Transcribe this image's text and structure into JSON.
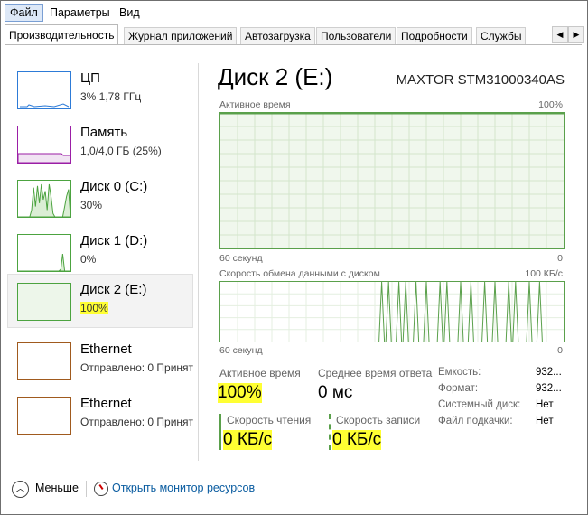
{
  "menu": {
    "items": [
      "Файл",
      "Параметры",
      "Вид"
    ]
  },
  "tabs": [
    "Производительность",
    "Журнал приложений",
    "Автозагрузка",
    "Пользователи",
    "Подробности",
    "Службы"
  ],
  "sidebar": {
    "items": [
      {
        "name": "ЦП",
        "sub": "3% 1,78 ГГц",
        "color": "#2d7bd7"
      },
      {
        "name": "Память",
        "sub": "1,0/4,0 ГБ (25%)",
        "color": "#9b1ea6"
      },
      {
        "name": "Диск 0 (C:)",
        "sub": "30%",
        "color": "#4ca340",
        "levels": [
          0,
          0,
          0,
          0,
          0,
          0,
          0,
          0.2,
          0.85,
          0.3,
          0.9,
          0.4,
          0.95,
          0.5,
          0.75,
          0.2,
          0.95,
          0.6,
          0.1,
          0,
          0,
          0,
          0,
          0,
          0.3,
          0.6,
          0.8,
          0
        ]
      },
      {
        "name": "Диск 1 (D:)",
        "sub": "0%",
        "color": "#4ca340",
        "levels": [
          0,
          0,
          0,
          0,
          0,
          0,
          0,
          0,
          0,
          0,
          0,
          0,
          0,
          0,
          0,
          0,
          0,
          0,
          0,
          0,
          0,
          0,
          0.05,
          0.5,
          0,
          0,
          0,
          0
        ]
      },
      {
        "name": "Диск 2 (E:)",
        "sub": "100%",
        "color": "#4ca340"
      },
      {
        "name": "Ethernet",
        "sub": "Отправлено: 0 Принят",
        "color": "#a05a1e"
      },
      {
        "name": "Ethernet",
        "sub": "Отправлено: 0 Принят",
        "color": "#a05a1e"
      }
    ]
  },
  "main": {
    "title": "Диск 2 (E:)",
    "model": "MAXTOR STM31000340AS",
    "graph1": {
      "label": "Активное время",
      "max": "100%",
      "time": "60 секунд",
      "min": "0",
      "level": 1.0
    },
    "graph2": {
      "label": "Скорость обмена данными с диском",
      "max": "100 КБ/с",
      "time": "60 секунд",
      "min": "0",
      "spikes": [
        0.47,
        0.49,
        0.52,
        0.54,
        0.57,
        0.6,
        0.64,
        0.66,
        0.7,
        0.73,
        0.77,
        0.8,
        0.84,
        0.86,
        0.9,
        0.93
      ]
    },
    "stats": {
      "active_label": "Активное время",
      "active_value": "100%",
      "resp_label": "Среднее время ответа",
      "resp_value": "0 мс",
      "read_label": "Скорость чтения",
      "read_value": "0 КБ/с",
      "write_label": "Скорость записи",
      "write_value": "0 КБ/с"
    },
    "props": [
      {
        "key": "Емкость:",
        "value": "932..."
      },
      {
        "key": "Формат:",
        "value": "932..."
      },
      {
        "key": "Системный диск:",
        "value": "Нет"
      },
      {
        "key": "Файл подкачки:",
        "value": "Нет"
      }
    ]
  },
  "footer": {
    "fewer": "Меньше",
    "monitor": "Открыть монитор ресурсов"
  }
}
